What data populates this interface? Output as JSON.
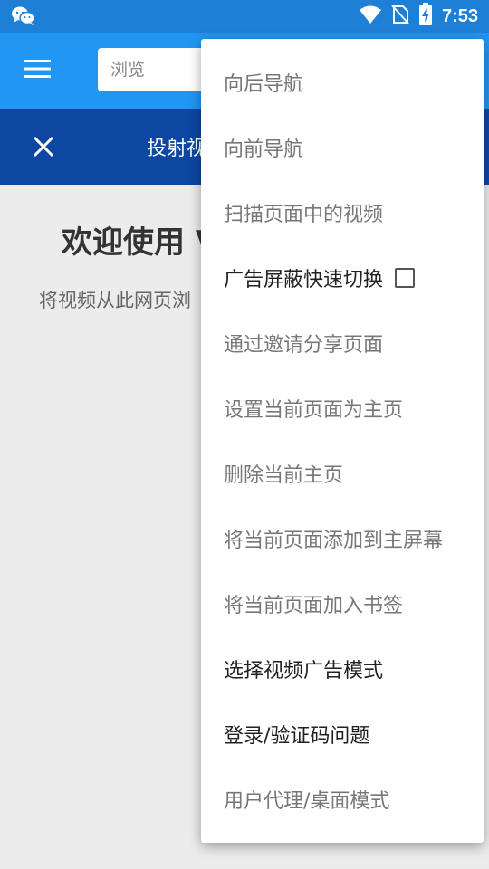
{
  "status_bar": {
    "time": "7:53",
    "icons": [
      "wechat-icon",
      "wifi-icon",
      "no-sim-icon",
      "battery-charging-icon"
    ]
  },
  "toolbar": {
    "search_placeholder": "浏览"
  },
  "cast_bar": {
    "title": "投射视"
  },
  "welcome": {
    "title": "欢迎使用 V",
    "description": "将视频从此网页浏"
  },
  "overflow_menu": {
    "items": [
      {
        "label": "向后导航",
        "enabled": false
      },
      {
        "label": "向前导航",
        "enabled": false
      },
      {
        "label": "扫描页面中的视频",
        "enabled": false
      },
      {
        "label": "广告屏蔽快速切换",
        "enabled": true,
        "checkbox": false
      },
      {
        "label": "通过邀请分享页面",
        "enabled": false
      },
      {
        "label": "设置当前页面为主页",
        "enabled": false
      },
      {
        "label": "删除当前主页",
        "enabled": false
      },
      {
        "label": "将当前页面添加到主屏幕",
        "enabled": false
      },
      {
        "label": "将当前页面加入书签",
        "enabled": false
      },
      {
        "label": "选择视频广告模式",
        "enabled": true
      },
      {
        "label": "登录/验证码问题",
        "enabled": true
      },
      {
        "label": "用户代理/桌面模式",
        "enabled": false
      }
    ]
  },
  "colors": {
    "status_bar": "#1e7fd6",
    "toolbar": "#2196f3",
    "cast_bar": "#0d47a1",
    "background": "#ececec"
  }
}
